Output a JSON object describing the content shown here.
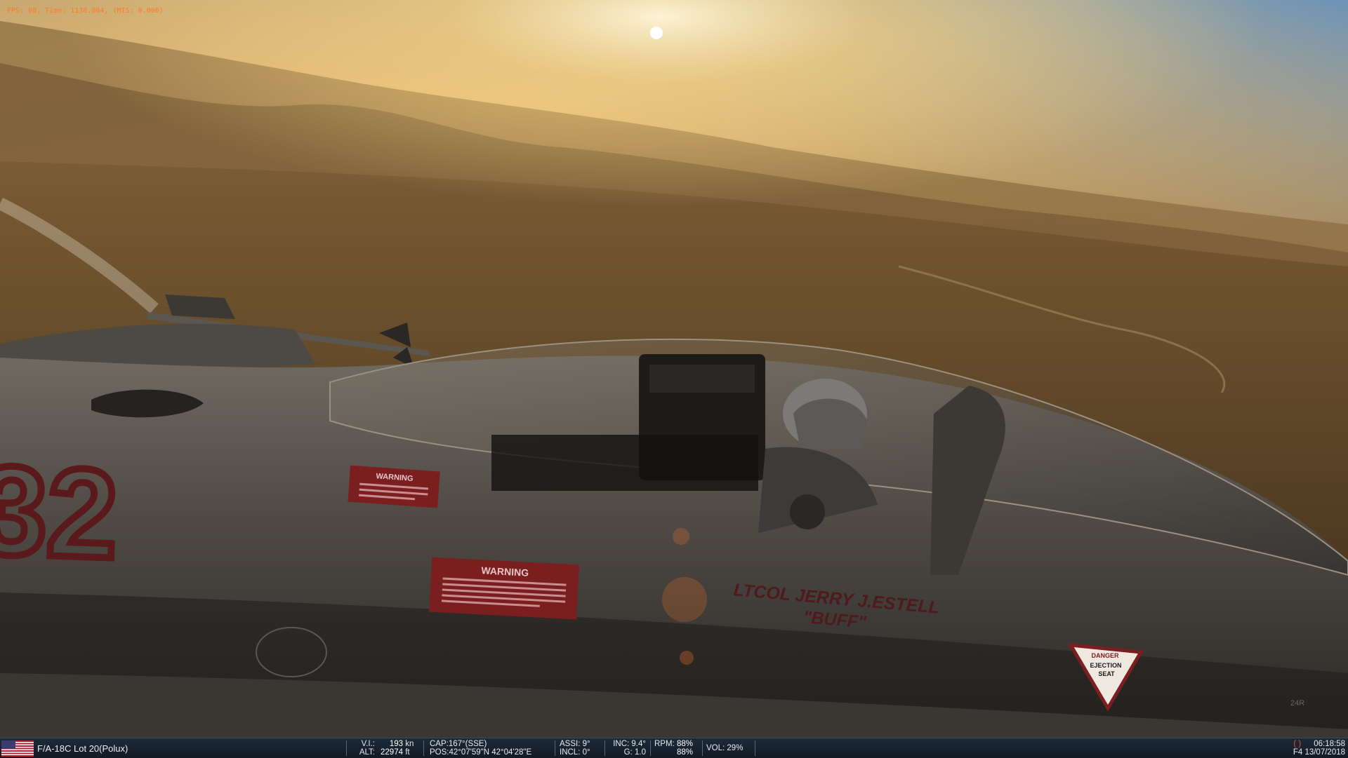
{
  "overlay": {
    "fps_line": "FPS:   98, Time: 1138.804, (MIS: 0.000)"
  },
  "scene": {
    "decal_warning_small_title": "WARNING",
    "decal_warning_large_title": "WARNING",
    "side_number": "32",
    "pilot_name_line1": "LTCOL JERRY J.ESTELL",
    "pilot_name_line2": "\"BUFF\"",
    "danger_label": "DANGER",
    "ejection_label": "EJECTION",
    "seat_label": "SEAT",
    "panel_code": "24R"
  },
  "status_bar": {
    "aircraft": "F/A-18C Lot 20(Polux)",
    "vi_label": "V.I.:",
    "vi_value": "193",
    "vi_unit": "kn",
    "alt_label": "ALT:",
    "alt_value": "22974",
    "alt_unit": "ft",
    "cap": "CAP:167°(SSE)",
    "pos": "POS:42°07'59\"N 42°04'28\"E",
    "assi": "ASSI: 9°",
    "incl": "INCL: 0°",
    "inc": "INC: 9.4°",
    "g": "G: 1.0",
    "rpm_label": "RPM:",
    "rpm_left": "88%",
    "rpm_right": "88%",
    "vol": "VOL: 29%",
    "paren": "( )",
    "time": "06:18:58",
    "date": "F4 13/07/2018"
  },
  "colors": {
    "overlay_text": "#ff7a2a",
    "status_bar_bg": "#1d2a38",
    "decal_red": "#7a1e20"
  }
}
